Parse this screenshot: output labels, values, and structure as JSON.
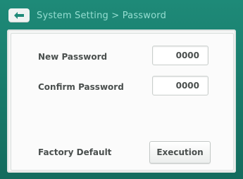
{
  "header": {
    "title": "System Setting > Password",
    "back_icon": "back-arrow-icon"
  },
  "form": {
    "new_password_label": "New Password",
    "new_password_value": "0000",
    "confirm_password_label": "Confirm Password",
    "confirm_password_value": "0000",
    "factory_default_label": "Factory Default",
    "execution_label": "Execution"
  },
  "colors": {
    "frame": "#1e8a78",
    "title_text": "#a9ece0",
    "panel": "#f5f6f5",
    "text": "#4a4f4e"
  }
}
